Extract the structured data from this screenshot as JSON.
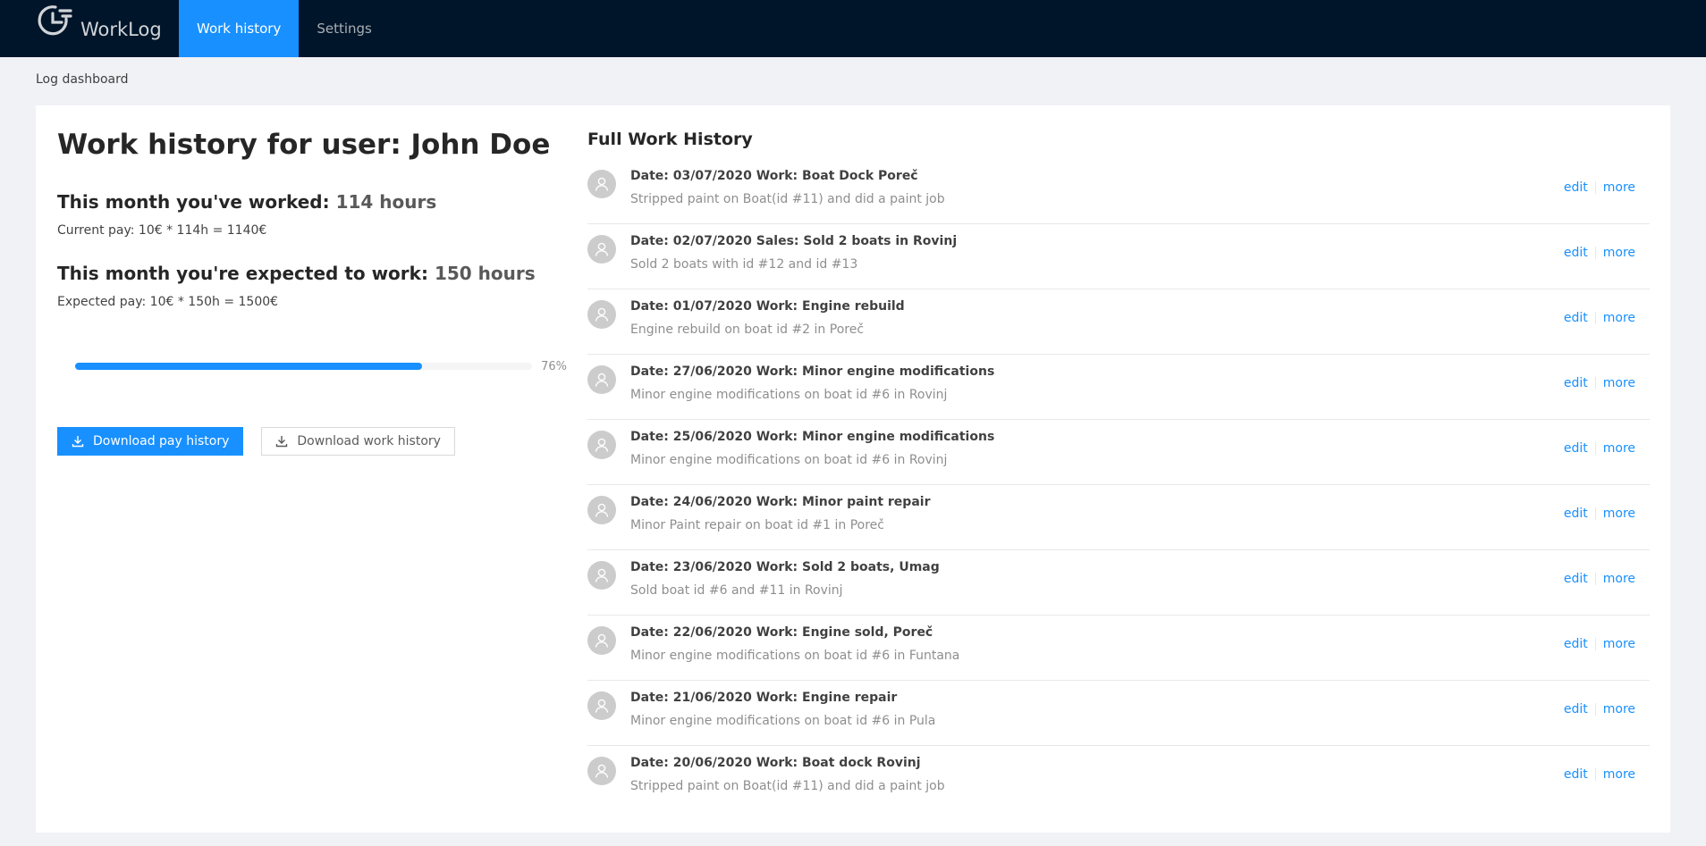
{
  "app": {
    "name": "WorkLog"
  },
  "nav": {
    "items": [
      {
        "label": "Work history"
      },
      {
        "label": "Settings"
      }
    ]
  },
  "breadcrumb": "Log dashboard",
  "summary": {
    "title": "Work history for user: John Doe",
    "worked_label": "This month you've worked:",
    "worked_value": "114 hours",
    "current_pay": "Current pay: 10€ * 114h = 1140€",
    "expected_label": "This month you're expected to work:",
    "expected_value": "150 hours",
    "expected_pay": "Expected pay: 10€ * 150h = 1500€",
    "progress_percent": 76,
    "progress_text": "76%",
    "download_pay_label": "Download pay history",
    "download_work_label": "Download work history"
  },
  "history": {
    "title": "Full Work History",
    "edit_label": "edit",
    "more_label": "more",
    "items": [
      {
        "title": "Date: 03/07/2020 Work: Boat Dock Poreč",
        "desc": "Stripped paint on Boat(id #11) and did a paint job"
      },
      {
        "title": "Date: 02/07/2020 Sales: Sold 2 boats in Rovinj",
        "desc": "Sold 2 boats with id #12 and id #13"
      },
      {
        "title": "Date: 01/07/2020 Work: Engine rebuild",
        "desc": "Engine rebuild on boat id #2 in Poreč"
      },
      {
        "title": "Date: 27/06/2020 Work: Minor engine modifications",
        "desc": "Minor engine modifications on boat id #6 in Rovinj"
      },
      {
        "title": "Date: 25/06/2020 Work: Minor engine modifications",
        "desc": "Minor engine modifications on boat id #6 in Rovinj"
      },
      {
        "title": "Date: 24/06/2020 Work: Minor paint repair",
        "desc": "Minor Paint repair on boat id #1 in Poreč"
      },
      {
        "title": "Date: 23/06/2020 Work: Sold 2 boats, Umag",
        "desc": "Sold boat id #6 and #11 in Rovinj"
      },
      {
        "title": "Date: 22/06/2020 Work: Engine sold, Poreč",
        "desc": "Minor engine modifications on boat id #6 in Funtana"
      },
      {
        "title": "Date: 21/06/2020 Work: Engine repair",
        "desc": "Minor engine modifications on boat id #6 in Pula"
      },
      {
        "title": "Date: 20/06/2020 Work: Boat dock Rovinj",
        "desc": "Stripped paint on Boat(id #11) and did a paint job"
      }
    ]
  }
}
